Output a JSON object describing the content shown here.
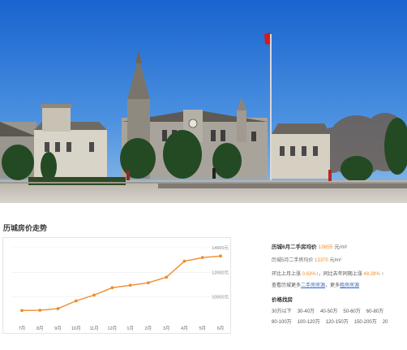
{
  "trend": {
    "title": "历城房价走势"
  },
  "chart_data": {
    "type": "line",
    "categories": [
      "7月",
      "8月",
      "9月",
      "10月",
      "11月",
      "12月",
      "1月",
      "2月",
      "3月",
      "4月",
      "5月",
      "6月"
    ],
    "series": [
      {
        "values": [
          8900,
          8920,
          9050,
          9680,
          10150,
          10750,
          10950,
          11150,
          11600,
          12900,
          13200,
          13320
        ]
      }
    ],
    "ylim": [
      8000,
      14000
    ],
    "yticks": [
      "14000元",
      "12000元",
      "10000元"
    ],
    "ytick_values": [
      14000,
      12000,
      10000
    ],
    "grid": true,
    "color": "#f08c2b"
  },
  "info": {
    "line1_pre": "历城6月二手房均价 ",
    "line1_val": "13655",
    "line1_unit": " 元/m²",
    "line2_pre": "历城5月二手房均价 ",
    "line2_val": "13370",
    "line2_unit": " 元/m²",
    "line3_pre": "环比上月上涨 ",
    "line3_val": "0.63%",
    "line3_mid": "↑，同比去年同期上涨 ",
    "line3_val2": "48.28%",
    "line3_end": " ↑",
    "line4_pre": "查看历城更多",
    "line4_link1": "二手房房源",
    "line4_mid": "，更多",
    "line4_link2": "租房房源",
    "ranges_title": "价格找房",
    "ranges_row1": [
      "30万以下",
      "30-40万",
      "40-50万",
      "50-60万",
      "60-80万"
    ],
    "ranges_row2": [
      "80-100万",
      "100-120万",
      "120-150万",
      "150-200万",
      "20"
    ]
  },
  "colors": {
    "accent": "#f08c2b",
    "link": "#3a6bc4",
    "sky": "#1f6fd0"
  }
}
